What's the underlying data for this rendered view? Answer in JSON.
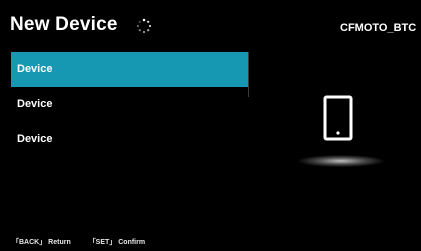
{
  "header": {
    "title": "New Device",
    "loading_icon": "spinner-icon",
    "device_name": "CFMOTO_BTC"
  },
  "device_list": {
    "items": [
      {
        "label": "Device",
        "selected": true
      },
      {
        "label": "Device",
        "selected": false
      },
      {
        "label": "Device",
        "selected": false
      }
    ],
    "selected_color": "#1698b2"
  },
  "preview": {
    "icon": "phone-icon"
  },
  "footer": {
    "back_hint": "「BACK」 Return",
    "set_hint": "「SET」 Confirm"
  }
}
